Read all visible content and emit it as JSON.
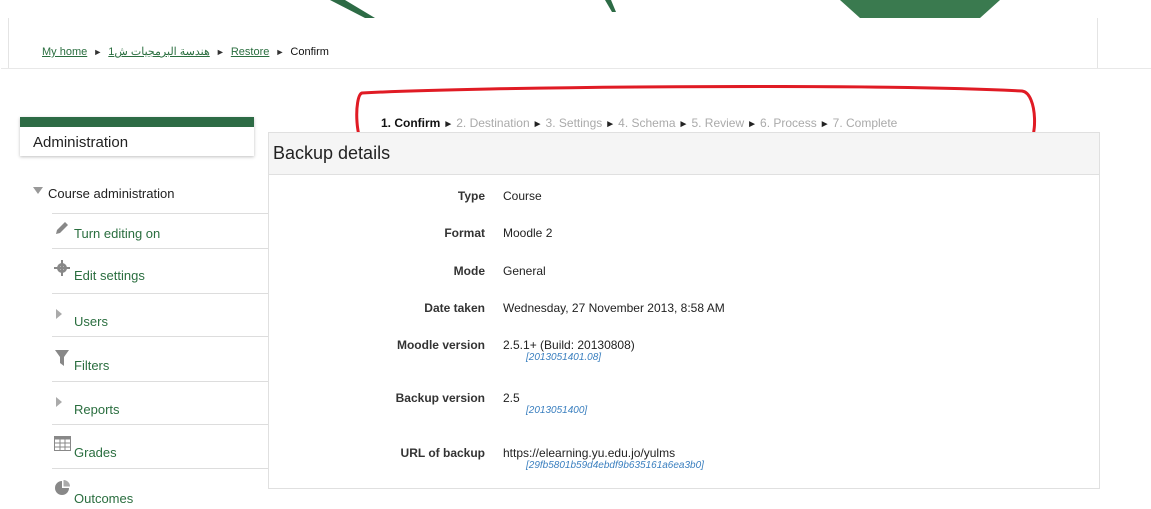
{
  "breadcrumb": {
    "home": "My home",
    "course": "هندسة البرمجيات ش1",
    "restore": "Restore",
    "current": "Confirm",
    "separator": "►"
  },
  "steps": {
    "separator": "►",
    "items": [
      {
        "label": "1. Confirm",
        "active": true
      },
      {
        "label": "2. Destination",
        "active": false
      },
      {
        "label": "3. Settings",
        "active": false
      },
      {
        "label": "4. Schema",
        "active": false
      },
      {
        "label": "5. Review",
        "active": false
      },
      {
        "label": "6. Process",
        "active": false
      },
      {
        "label": "7. Complete",
        "active": false
      }
    ]
  },
  "sidebar": {
    "title": "Administration",
    "course_admin": "Course administration",
    "items": [
      {
        "label": "Turn editing on",
        "icon": "pencil-icon"
      },
      {
        "label": "Edit settings",
        "icon": "gear-icon"
      },
      {
        "label": "Users",
        "icon": "triangle-right-icon"
      },
      {
        "label": "Filters",
        "icon": "filter-icon"
      },
      {
        "label": "Reports",
        "icon": "triangle-right-icon"
      },
      {
        "label": "Grades",
        "icon": "grid-icon"
      },
      {
        "label": "Outcomes",
        "icon": "pie-icon"
      }
    ]
  },
  "main": {
    "title": "Backup details",
    "rows": [
      {
        "key": "Type",
        "value": "Course",
        "sub": ""
      },
      {
        "key": "Format",
        "value": "Moodle 2",
        "sub": ""
      },
      {
        "key": "Mode",
        "value": "General",
        "sub": ""
      },
      {
        "key": "Date taken",
        "value": "Wednesday, 27 November 2013, 8:58 AM",
        "sub": ""
      },
      {
        "key": "Moodle version",
        "value": "2.5.1+ (Build: 20130808)",
        "sub": "[2013051401.08]"
      },
      {
        "key": "Backup version",
        "value": "2.5",
        "sub": "[2013051400]"
      },
      {
        "key": "URL of backup",
        "value": "https://elearning.yu.edu.jo/yulms",
        "sub": "[29fb5801b59d4ebdf9b635161a6ea3b0]"
      }
    ]
  },
  "colors": {
    "accent": "#2d6b45",
    "link": "#2a6e3f",
    "annotation": "#e01b24",
    "sub_link": "#3a7fbf"
  }
}
